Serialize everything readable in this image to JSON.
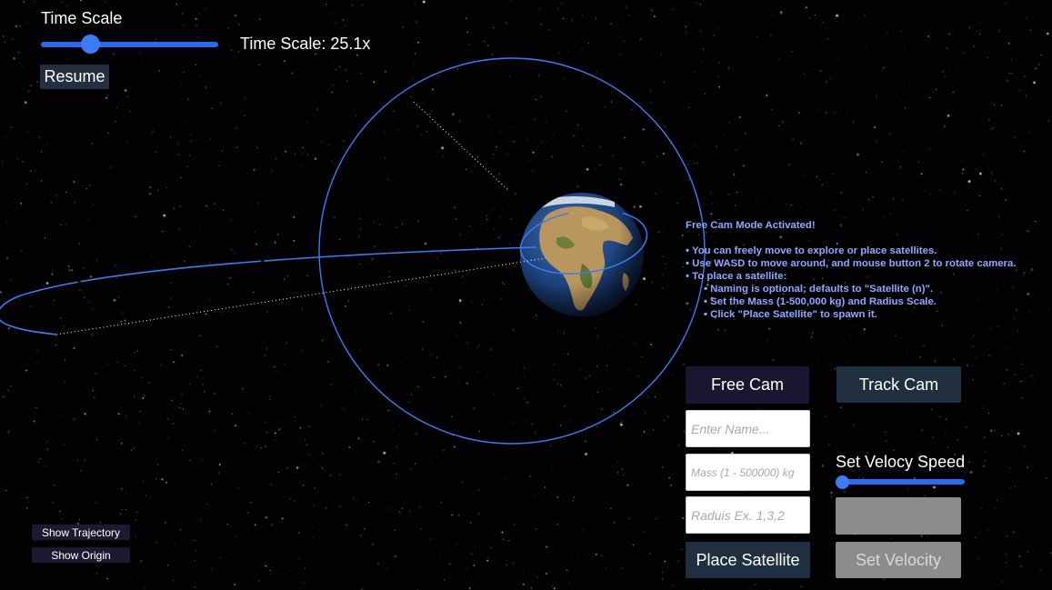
{
  "time_scale": {
    "label": "Time Scale",
    "value_text": "Time Scale: 25.1x",
    "slider_fraction": 0.25,
    "resume_label": "Resume"
  },
  "info_panel": {
    "title": "Free Cam Mode Activated!",
    "lines": [
      "• You can freely move to explore or place satellites.",
      "• Use WASD to move around, and mouse button 2 to rotate camera.",
      "• To place a satellite:"
    ],
    "sub_lines": [
      "• Naming is optional; defaults to \"Satellite (n)\".",
      "• Set the Mass (1-500,000 kg) and Radius Scale.",
      "• Click \"Place Satellite\" to spawn it."
    ],
    "color": "#8fa8ff"
  },
  "camera": {
    "free_cam_label": "Free Cam",
    "track_cam_label": "Track Cam"
  },
  "satellite_form": {
    "name_placeholder": "Enter Name...",
    "mass_placeholder": "Mass (1 - 500000) kg",
    "radius_placeholder": "Raduis Ex. 1,3,2",
    "place_label": "Place Satellite"
  },
  "velocity": {
    "label": "Set Velocy Speed",
    "slider_fraction": 0.0,
    "set_label": "Set Velocity"
  },
  "toggles": {
    "trajectory_label": "Show Trajectory",
    "origin_label": "Show Origin"
  },
  "colors": {
    "orbit": "#3d7cf0",
    "accent": "#2a6af0",
    "dark_button": "#203040"
  },
  "icons": [
    "earth-globe",
    "orbit-line",
    "trajectory-dots"
  ]
}
